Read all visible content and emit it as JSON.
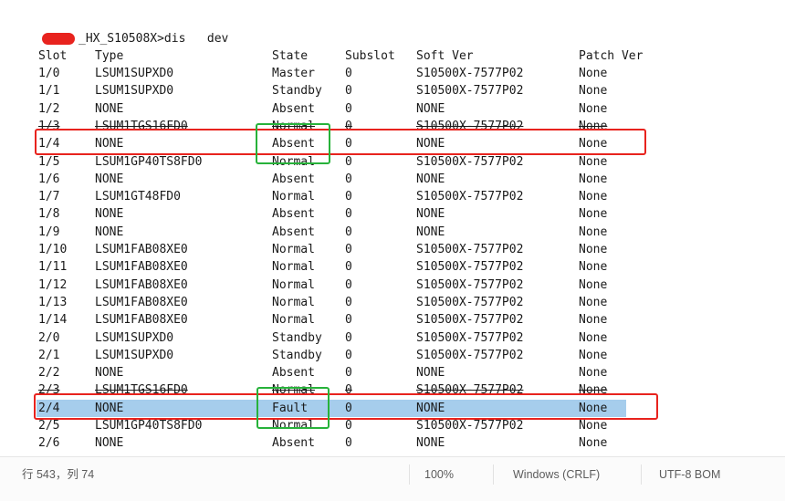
{
  "terminal": {
    "prompt_suffix": "_HX_S10508X>dis   dev",
    "headers": {
      "slot": "Slot",
      "type": "Type",
      "state": "State",
      "subslot": "Subslot",
      "soft_ver": "Soft Ver",
      "patch_ver": "Patch Ver"
    },
    "rows": [
      {
        "slot": "1/0",
        "type": "LSUM1SUPXD0",
        "state": "Master",
        "subslot": "0",
        "soft": "S10500X-7577P02",
        "patch": "None"
      },
      {
        "slot": "1/1",
        "type": "LSUM1SUPXD0",
        "state": "Standby",
        "subslot": "0",
        "soft": "S10500X-7577P02",
        "patch": "None"
      },
      {
        "slot": "1/2",
        "type": "NONE",
        "state": "Absent",
        "subslot": "0",
        "soft": "NONE",
        "patch": "None"
      },
      {
        "slot": "1/3",
        "type": "LSUM1TGS16FD0",
        "state": "Normal",
        "subslot": "0",
        "soft": "S10500X-7577P02",
        "patch": "None"
      },
      {
        "slot": "1/4",
        "type": "NONE",
        "state": "Absent",
        "subslot": "0",
        "soft": "NONE",
        "patch": "None"
      },
      {
        "slot": "1/5",
        "type": "LSUM1GP40TS8FD0",
        "state": "Normal",
        "subslot": "0",
        "soft": "S10500X-7577P02",
        "patch": "None"
      },
      {
        "slot": "1/6",
        "type": "NONE",
        "state": "Absent",
        "subslot": "0",
        "soft": "NONE",
        "patch": "None"
      },
      {
        "slot": "1/7",
        "type": "LSUM1GT48FD0",
        "state": "Normal",
        "subslot": "0",
        "soft": "S10500X-7577P02",
        "patch": "None"
      },
      {
        "slot": "1/8",
        "type": "NONE",
        "state": "Absent",
        "subslot": "0",
        "soft": "NONE",
        "patch": "None"
      },
      {
        "slot": "1/9",
        "type": "NONE",
        "state": "Absent",
        "subslot": "0",
        "soft": "NONE",
        "patch": "None"
      },
      {
        "slot": "1/10",
        "type": "LSUM1FAB08XE0",
        "state": "Normal",
        "subslot": "0",
        "soft": "S10500X-7577P02",
        "patch": "None"
      },
      {
        "slot": "1/11",
        "type": "LSUM1FAB08XE0",
        "state": "Normal",
        "subslot": "0",
        "soft": "S10500X-7577P02",
        "patch": "None"
      },
      {
        "slot": "1/12",
        "type": "LSUM1FAB08XE0",
        "state": "Normal",
        "subslot": "0",
        "soft": "S10500X-7577P02",
        "patch": "None"
      },
      {
        "slot": "1/13",
        "type": "LSUM1FAB08XE0",
        "state": "Normal",
        "subslot": "0",
        "soft": "S10500X-7577P02",
        "patch": "None"
      },
      {
        "slot": "1/14",
        "type": "LSUM1FAB08XE0",
        "state": "Normal",
        "subslot": "0",
        "soft": "S10500X-7577P02",
        "patch": "None"
      },
      {
        "slot": "2/0",
        "type": "LSUM1SUPXD0",
        "state": "Standby",
        "subslot": "0",
        "soft": "S10500X-7577P02",
        "patch": "None"
      },
      {
        "slot": "2/1",
        "type": "LSUM1SUPXD0",
        "state": "Standby",
        "subslot": "0",
        "soft": "S10500X-7577P02",
        "patch": "None"
      },
      {
        "slot": "2/2",
        "type": "NONE",
        "state": "Absent",
        "subslot": "0",
        "soft": "NONE",
        "patch": "None"
      },
      {
        "slot": "2/3",
        "type": "LSUM1TGS16FD0",
        "state": "Normal",
        "subslot": "0",
        "soft": "S10500X-7577P02",
        "patch": "None"
      },
      {
        "slot": "2/4",
        "type": "NONE",
        "state": "Fault",
        "subslot": "0",
        "soft": "NONE",
        "patch": "None"
      },
      {
        "slot": "2/5",
        "type": "LSUM1GP40TS8FD0",
        "state": "Normal",
        "subslot": "0",
        "soft": "S10500X-7577P02",
        "patch": "None"
      },
      {
        "slot": "2/6",
        "type": "NONE",
        "state": "Absent",
        "subslot": "0",
        "soft": "NONE",
        "patch": "None"
      }
    ]
  },
  "status_bar": {
    "position": "行 543，列 74",
    "zoom": "100%",
    "line_ending": "Windows (CRLF)",
    "encoding": "UTF-8 BOM"
  },
  "colors": {
    "highlight_red": "#e8231e",
    "highlight_green": "#27b23a",
    "selection": "#a6cdec"
  }
}
